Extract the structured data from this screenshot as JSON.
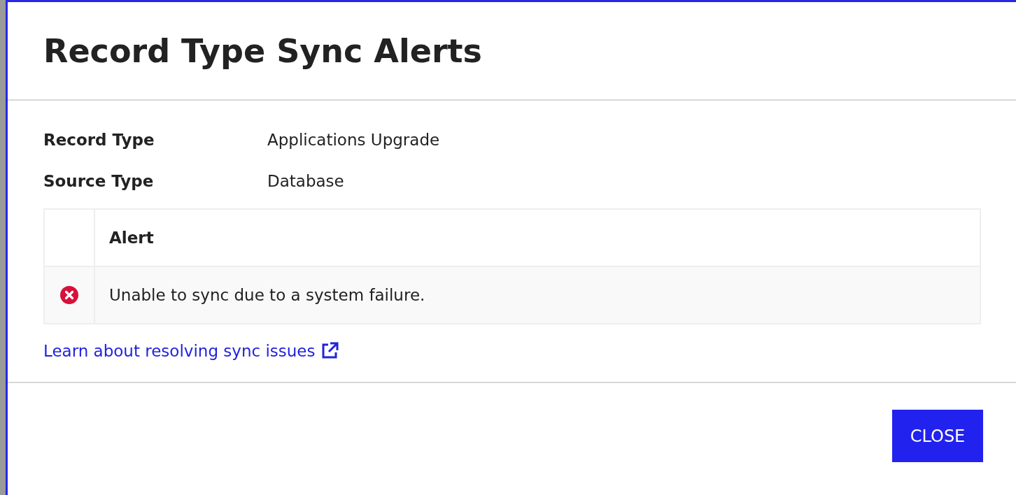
{
  "dialog": {
    "title": "Record Type Sync Alerts",
    "fields": [
      {
        "label": "Record Type",
        "value": "Applications Upgrade"
      },
      {
        "label": "Source Type",
        "value": "Database"
      }
    ],
    "table": {
      "columns": [
        "Alert"
      ],
      "rows": [
        {
          "kind": "error",
          "message": "Unable to sync due to a system failure."
        }
      ]
    },
    "link": "Learn about resolving sync issues",
    "buttons": [
      "CLOSE"
    ]
  }
}
